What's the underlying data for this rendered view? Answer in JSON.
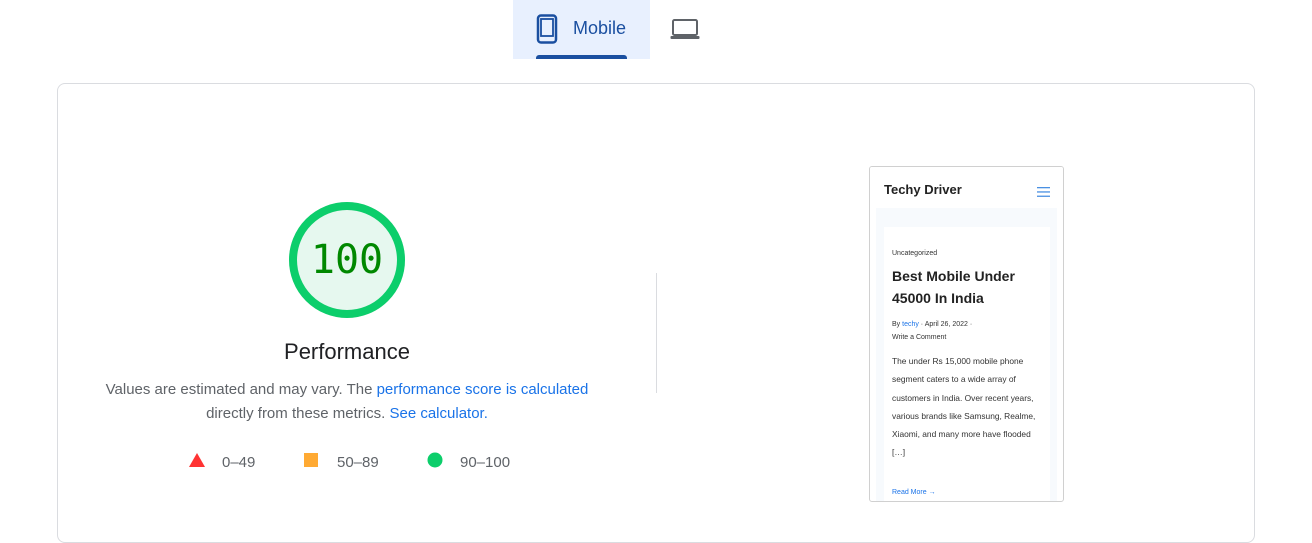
{
  "tabs": {
    "mobile_label": "Mobile",
    "desktop_label": "Desktop",
    "active": "mobile"
  },
  "score": {
    "value": "100",
    "fraction": 1.0,
    "label": "Performance",
    "color": "#0cce6b",
    "text_color": "#008800"
  },
  "description": {
    "part1": "Values are estimated and may vary. The ",
    "link1": "performance score is calculated",
    "part2": "directly from these metrics. ",
    "link2": "See calculator."
  },
  "legend": {
    "fail": "0–49",
    "average": "50–89",
    "pass": "90–100",
    "fail_color": "#ff3333",
    "average_color": "#ffaa33",
    "pass_color": "#0cce6b"
  },
  "preview": {
    "site_title": "Techy Driver",
    "category": "Uncategorized",
    "post_title": "Best Mobile Under 45000 In India",
    "by": "By ",
    "author": "techy",
    "sep1": " · ",
    "date": "April 26, 2022",
    "sep2": " · ",
    "comment": "Write a Comment",
    "excerpt": "The under Rs 15,000 mobile phone segment caters to a wide array of customers in India. Over recent years, various brands like Samsung, Realme, Xiaomi, and many more have flooded […]",
    "read_more": "Read More →"
  }
}
